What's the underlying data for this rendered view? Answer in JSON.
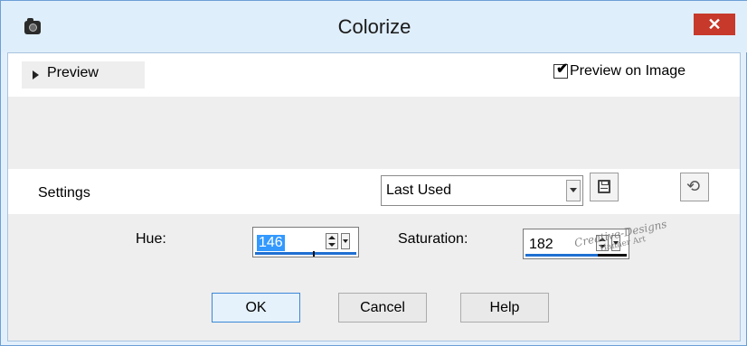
{
  "window": {
    "title": "Colorize",
    "close_glyph": "✕",
    "app_icon": "camera-icon",
    "accent_close": "#c7392a",
    "titlebar_bg": "#dfeefb"
  },
  "preview": {
    "header_label": "Preview",
    "preview_on_image_label": "Preview on Image",
    "preview_on_image_checked": true
  },
  "settings": {
    "label": "Settings",
    "preset_value": "Last Used",
    "save_icon": "floppy-disk-icon",
    "reset_icon": "reset-defaults-icon"
  },
  "params": {
    "hue_label": "Hue:",
    "hue_value": "146",
    "hue_fraction": 0.57,
    "saturation_label": "Saturation:",
    "saturation_value": "182",
    "saturation_fraction": 0.71
  },
  "buttons": {
    "ok": "OK",
    "cancel": "Cancel",
    "help": "Help"
  },
  "watermark": {
    "line1": "Creative-Designs",
    "line2": "Hanner Art"
  }
}
